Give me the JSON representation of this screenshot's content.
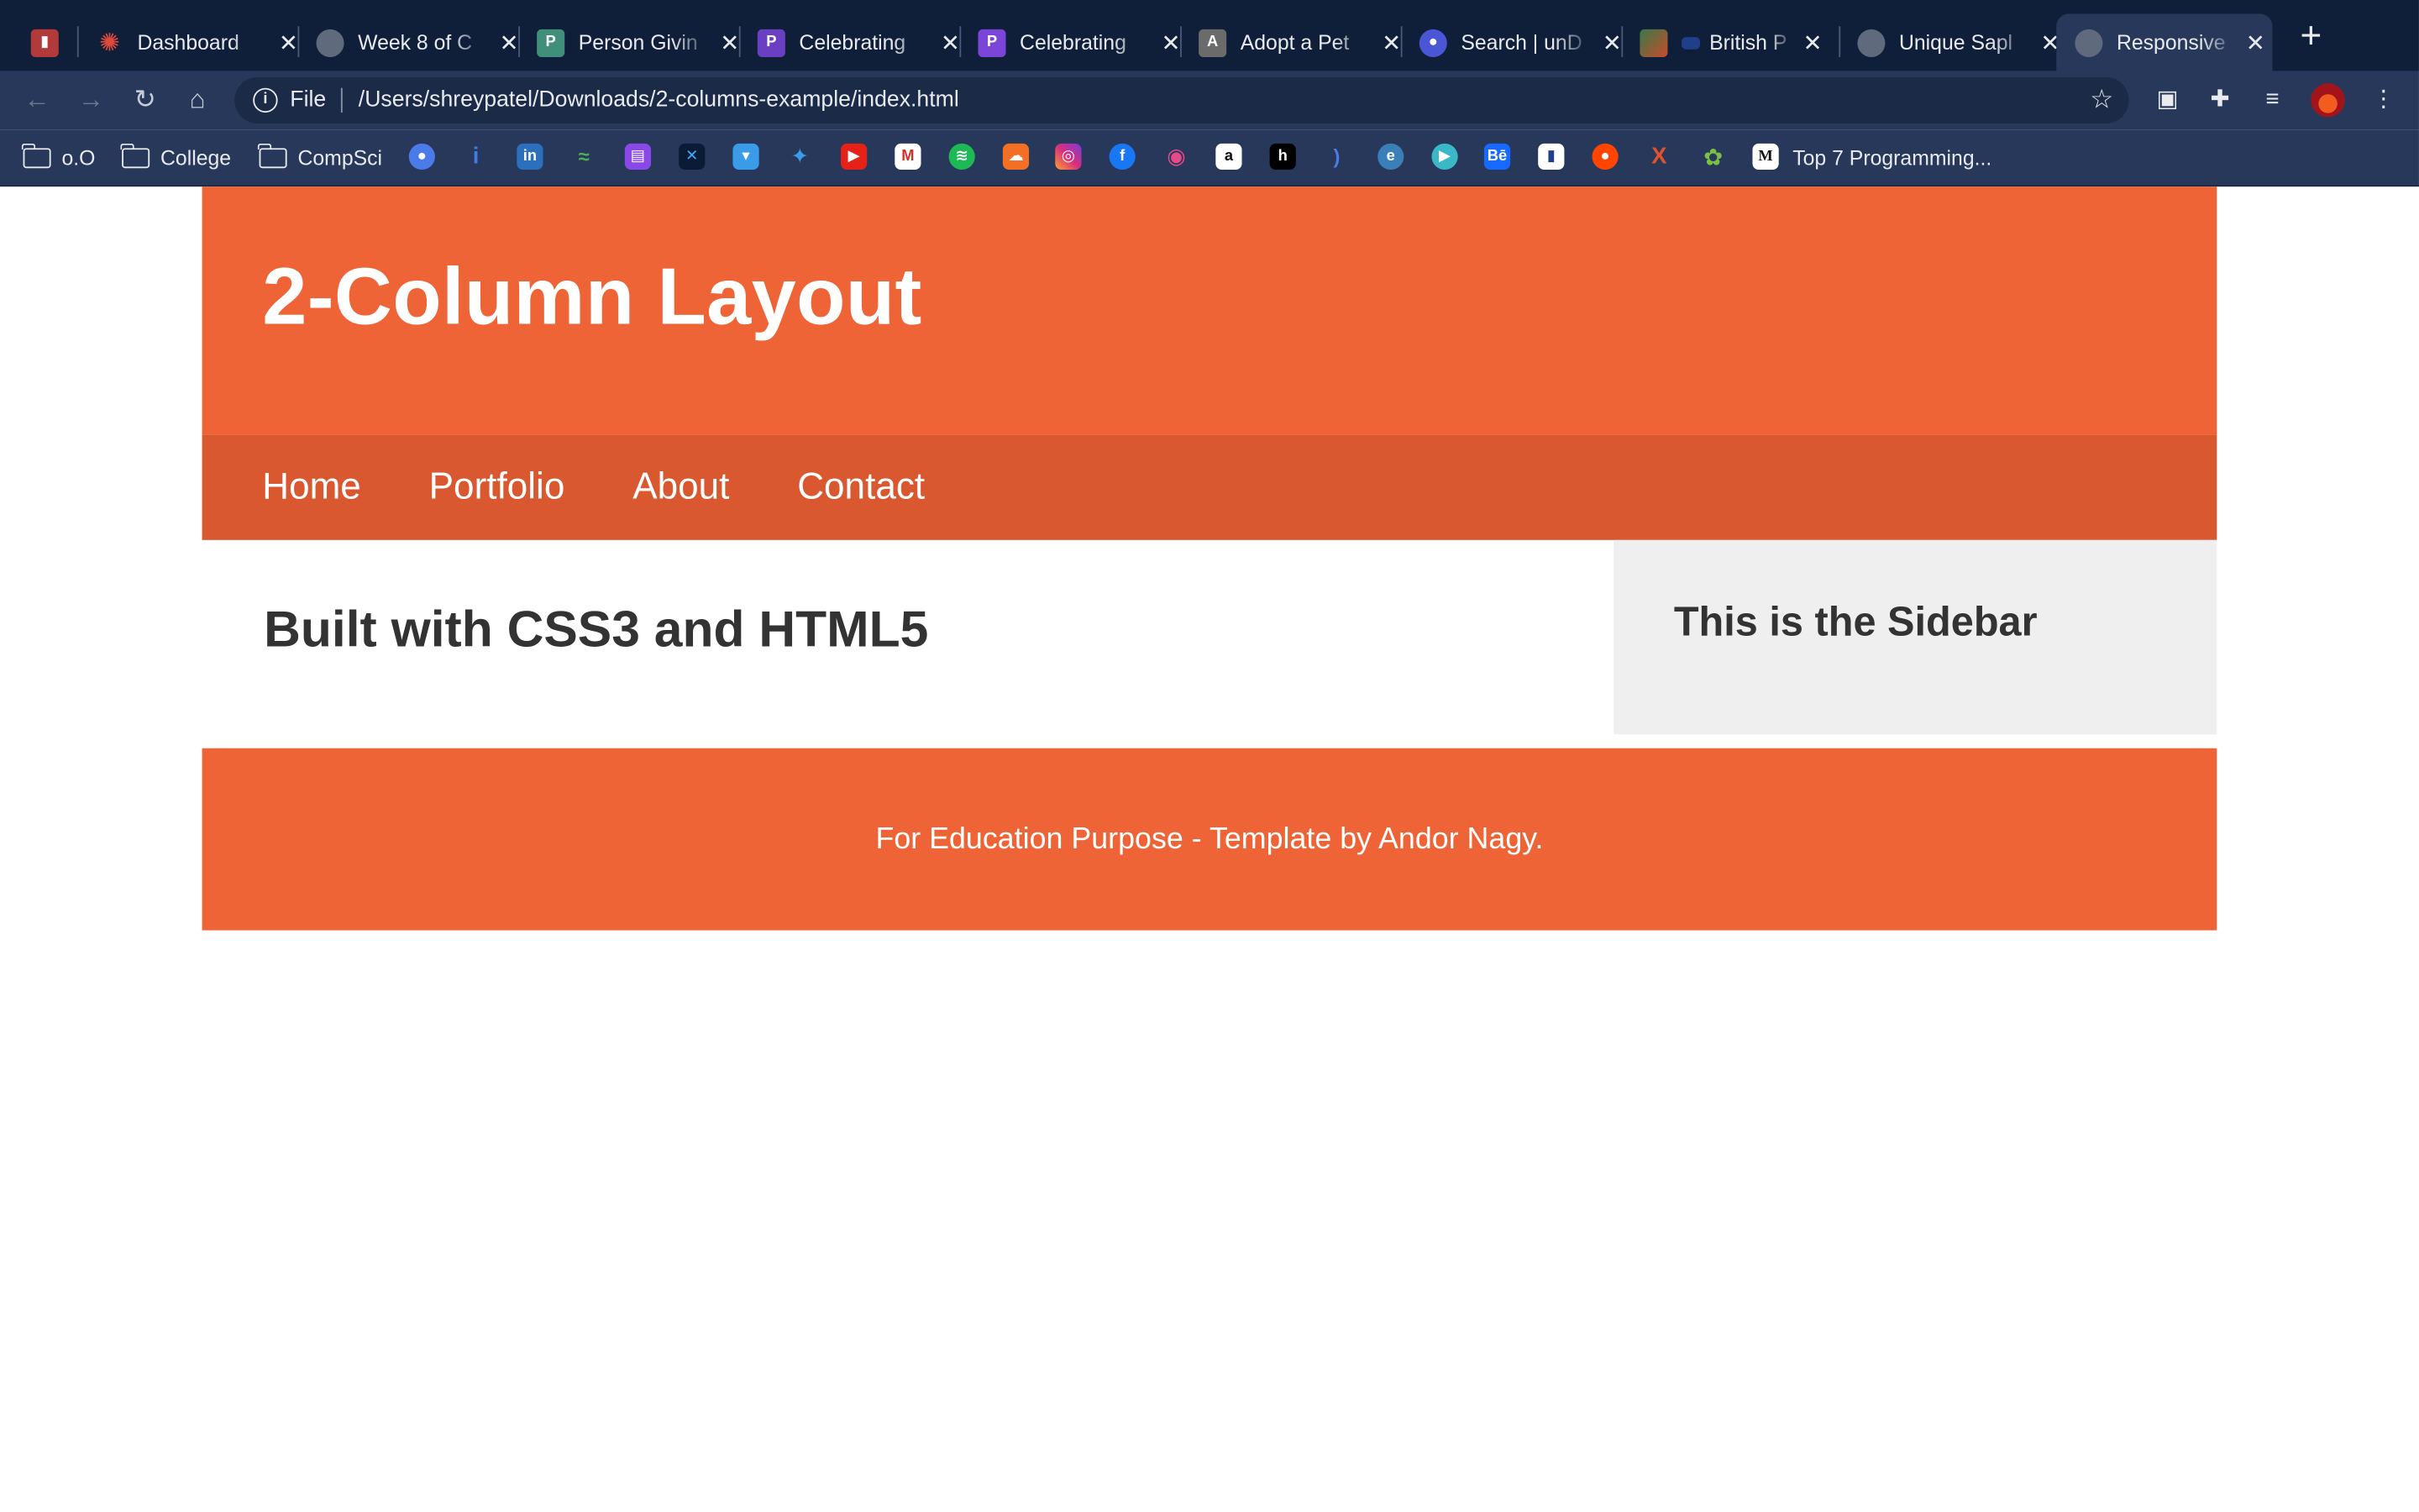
{
  "browser": {
    "tabs": [
      {
        "title": "",
        "icon": "brand-icon",
        "color": "#b33a3a"
      },
      {
        "title": "Dashboard",
        "icon": "dashboard-icon",
        "color": "#e04a3b"
      },
      {
        "title": "Week 8 of C",
        "icon": "globe-icon",
        "color": "#5f6b7d"
      },
      {
        "title": "Person Givin",
        "icon": "pluralsight-icon",
        "color": "#3f8f7b"
      },
      {
        "title": "Celebrating",
        "icon": "pg-icon",
        "color": "#6a3fc1"
      },
      {
        "title": "Celebrating",
        "icon": "pg-icon",
        "color": "#7b45d9"
      },
      {
        "title": "Adopt a Pet",
        "icon": "adopt-icon",
        "color": "#6b6b6b"
      },
      {
        "title": "Search | unD",
        "icon": "search-site-icon",
        "color": "#4a56d6"
      },
      {
        "title": "British P",
        "icon": "british-flag-icon",
        "color": "#c8102e"
      },
      {
        "title": "Unique Sapl",
        "icon": "globe-icon",
        "color": "#5f6b7d"
      },
      {
        "title": "Responsive",
        "icon": "globe-icon",
        "color": "#5f6b7d"
      }
    ],
    "new_tab_label": "+",
    "address": {
      "scheme_label": "File",
      "url": "/Users/shreypatel/Downloads/2-columns-example/index.html"
    },
    "bookmarks": {
      "folders": [
        "o.O",
        "College",
        "CompSci"
      ],
      "last_label": "Top 7 Programming..."
    }
  },
  "site": {
    "title": "2-Column Layout",
    "nav": [
      "Home",
      "Portfolio",
      "About",
      "Contact"
    ],
    "main_heading": "Built with CSS3 and HTML5",
    "sidebar_heading": "This is the Sidebar",
    "footer_text": "For Education Purpose - Template by Andor Nagy.",
    "colors": {
      "header": "#ee6436",
      "nav": "#d9582f",
      "sidebar": "#efefef",
      "text": "#333333"
    }
  }
}
